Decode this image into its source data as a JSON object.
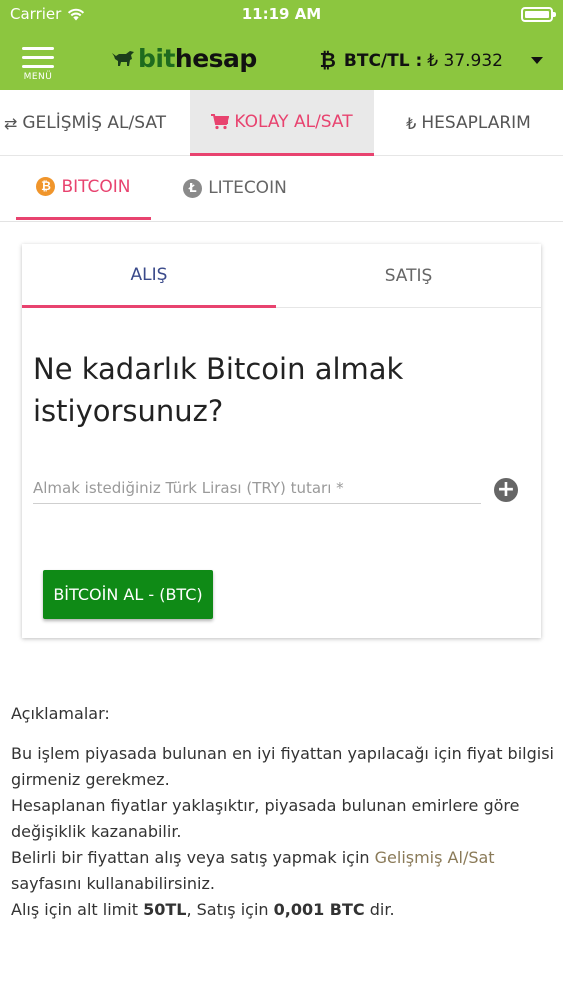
{
  "status_bar": {
    "carrier": "Carrier",
    "time": "11:19 AM"
  },
  "header": {
    "menu_label": "MENÜ",
    "logo_bit": "bit",
    "logo_hesap": "hesap",
    "price_label": "BTC/TL :",
    "price_value": "₺ 37.932",
    "btc_symbol": "₿"
  },
  "main_tabs": [
    {
      "icon": "⇄",
      "label": "GELİŞMİŞ AL/SAT"
    },
    {
      "icon": "🛒",
      "label": "KOLAY AL/SAT"
    },
    {
      "icon": "₺",
      "label": "HESAPLARIM"
    }
  ],
  "coin_tabs": [
    {
      "badge": "₿",
      "label": "BITCOIN"
    },
    {
      "badge": "Ł",
      "label": "LITECOIN"
    }
  ],
  "card": {
    "tabs": {
      "buy": "ALIŞ",
      "sell": "SATIŞ"
    },
    "question": "Ne kadarlık Bitcoin almak istiyorsunuz?",
    "amount_placeholder": "Almak istediğiniz Türk Lirası (TRY) tutarı *",
    "add_symbol": "+",
    "buy_button": "BİTCOİN AL - (BTC)"
  },
  "notes": {
    "title": "Açıklamalar:",
    "line1": "Bu işlem piyasada bulunan en iyi fiyattan yapılacağı için fiyat bilgisi girmeniz gerekmez.",
    "line2": "Hesaplanan fiyatlar yaklaşıktır, piyasada bulunan emirlere göre değişiklik kazanabilir.",
    "line3_pre": "Belirli bir fiyattan alış veya satış yapmak için ",
    "line3_link": "Gelişmiş Al/Sat",
    "line3_post": " sayfasını kullanabilirsiniz.",
    "line4_pre": "Alış için alt limit ",
    "line4_buy_limit": "50TL",
    "line4_mid": ", Satış için ",
    "line4_sell_limit": "0,001 BTC",
    "line4_post": " dir."
  },
  "colors": {
    "brand_green": "#8cc63f",
    "accent_pink": "#e8436f",
    "button_green": "#0f8a16",
    "bitcoin_orange": "#f0952b"
  }
}
